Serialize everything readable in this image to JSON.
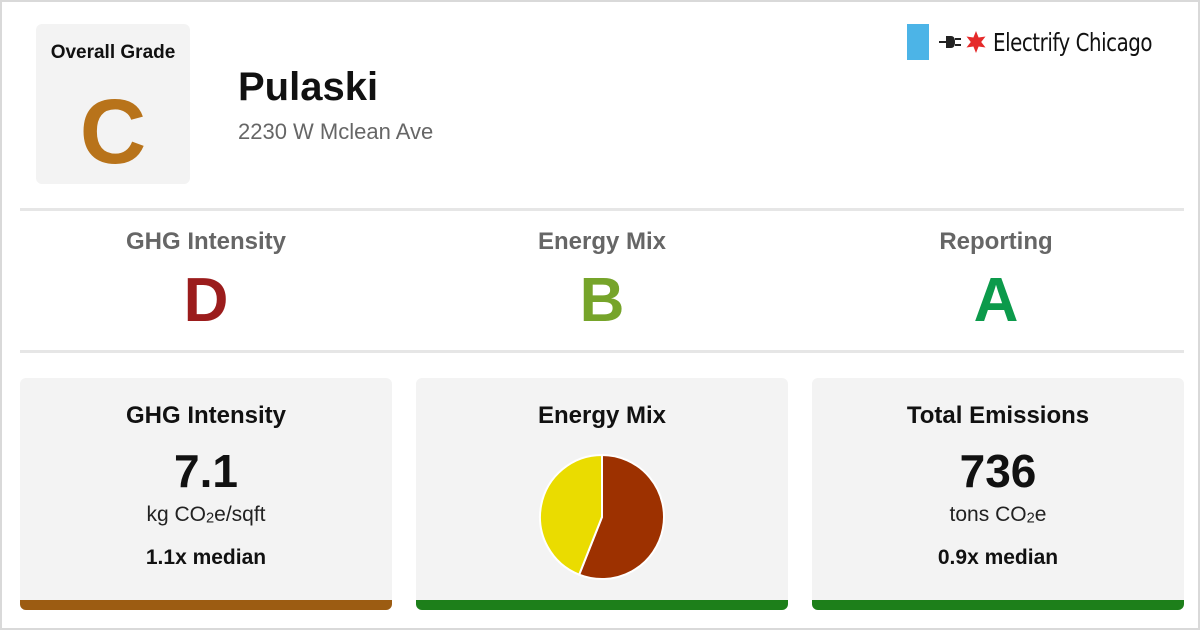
{
  "colors": {
    "grade_c": "#b8731a",
    "grade_d": "#9b1c1c",
    "grade_b": "#76a42a",
    "grade_a": "#0c9a4b",
    "bar_ghg": "#9c5c12",
    "bar_green": "#1d7f1a",
    "pie_electric": "#eadc00",
    "pie_gas": "#9d3100",
    "logo_flag": "#4cb4e7",
    "logo_star": "#e52a2a"
  },
  "overall": {
    "label": "Overall Grade",
    "grade": "C"
  },
  "building": {
    "name": "Pulaski",
    "address": "2230 W Mclean Ave"
  },
  "logo": {
    "text": "Electrify Chicago",
    "icons": [
      "chicago-flag-stripe-icon",
      "plug-icon",
      "red-star-icon"
    ]
  },
  "subgrades": [
    {
      "label": "GHG Intensity",
      "grade": "D"
    },
    {
      "label": "Energy Mix",
      "grade": "B"
    },
    {
      "label": "Reporting",
      "grade": "A"
    }
  ],
  "cards": {
    "ghg": {
      "title": "GHG Intensity",
      "value": "7.1",
      "unit_main": "kg CO",
      "unit_sub": "2",
      "unit_tail": "e/sqft",
      "median": "1.1x median"
    },
    "mix": {
      "title": "Energy Mix"
    },
    "emissions": {
      "title": "Total Emissions",
      "value": "736",
      "unit_main": "tons CO",
      "unit_sub": "2",
      "unit_tail": "e",
      "median": "0.9x median"
    }
  },
  "chart_data": {
    "type": "pie",
    "labels": [],
    "values": [
      0.56,
      0.44
    ],
    "colors": [
      "#9d3100",
      "#eadc00"
    ]
  }
}
